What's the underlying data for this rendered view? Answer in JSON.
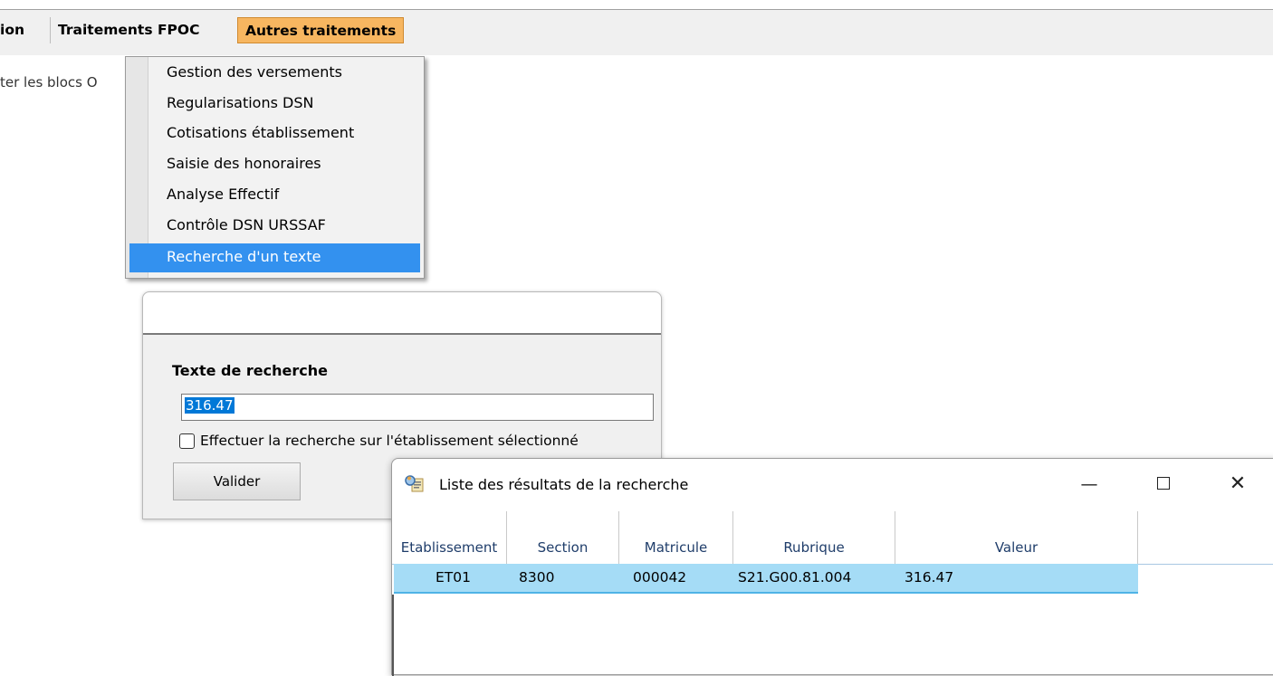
{
  "menubar": {
    "items": [
      {
        "label": "ion"
      },
      {
        "label": "Traitements FPOC"
      },
      {
        "label": "Autres traitements"
      }
    ]
  },
  "background_text": "ter les blocs O",
  "dropdown": {
    "items": [
      "Gestion des versements",
      "Regularisations DSN",
      "Cotisations établissement",
      "Saisie des honoraires",
      "Analyse Effectif",
      "Contrôle DSN URSSAF",
      "Recherche d'un texte"
    ],
    "selected": "Recherche d'un texte"
  },
  "search_dialog": {
    "label": "Texte de recherche",
    "input_value": "316.47",
    "checkbox_label": "Effectuer la recherche sur l'établissement sélectionné",
    "checkbox_checked": false,
    "submit_label": "Valider"
  },
  "results_window": {
    "title": "Liste des résultats de la recherche",
    "minimize_glyph": "—",
    "close_glyph": "✕",
    "columns": [
      "Etablissement",
      "Section",
      "Matricule",
      "Rubrique",
      "Valeur"
    ],
    "rows": [
      {
        "etablissement": "ET01",
        "section": "8300",
        "matricule": "000042",
        "rubrique": "S21.G00.81.004",
        "valeur": "316.47"
      }
    ],
    "selected_row_color": "#a5dcf6"
  },
  "colors": {
    "active_menu": "#f7b660",
    "selection_blue": "#3391ef"
  }
}
